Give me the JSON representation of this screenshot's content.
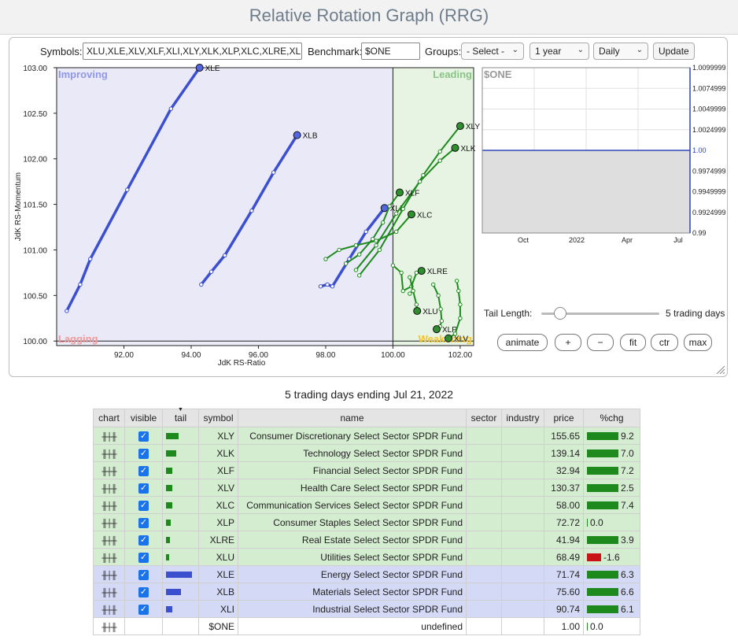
{
  "page": {
    "title": "Relative Rotation Graph (RRG)"
  },
  "controls": {
    "symbols_label": "Symbols:",
    "symbols_value": "XLU,XLE,XLV,XLF,XLI,XLY,XLK,XLP,XLC,XLRE,XLB",
    "benchmark_label": "Benchmark:",
    "benchmark_value": "$ONE",
    "groups_label": "Groups:",
    "groups_value": "- Select -",
    "period_value": "1 year",
    "frequency_value": "Daily",
    "update_label": "Update"
  },
  "chart_data": [
    {
      "type": "scatter",
      "title": "",
      "xlabel": "JdK RS-Ratio",
      "ylabel": "JdK RS-Momentum",
      "xlim": [
        90.0,
        102.4
      ],
      "ylim": [
        99.95,
        103.0
      ],
      "x_ticks": [
        "92.00",
        "94.00",
        "96.00",
        "98.00",
        "100.00",
        "102.00"
      ],
      "y_ticks": [
        "100.00",
        "100.50",
        "101.00",
        "101.50",
        "102.00",
        "102.50",
        "103.00"
      ],
      "quadrants": {
        "top_left": "Improving",
        "top_right": "Leading",
        "bottom_left": "Lagging",
        "bottom_right": "Weakening"
      },
      "colors": {
        "improving": "#e9e9f7",
        "leading": "#e8f4e3",
        "lagging": "#ececf8",
        "weakening": "#e8f4e3",
        "improving_text": "#8f97e6",
        "leading_text": "#88c585",
        "lagging_text": "#ef9a9a",
        "weakening_text": "#f4c430",
        "blue": "#3b4fcf",
        "green": "#1e8a1e"
      },
      "series": [
        {
          "name": "XLE",
          "color": "blue",
          "points": [
            [
              90.3,
              100.33
            ],
            [
              90.7,
              100.62
            ],
            [
              91.0,
              100.9
            ],
            [
              92.1,
              101.66
            ],
            [
              93.4,
              102.55
            ],
            [
              94.25,
              103.0
            ]
          ]
        },
        {
          "name": "XLB",
          "color": "blue",
          "points": [
            [
              94.3,
              100.62
            ],
            [
              94.6,
              100.76
            ],
            [
              95.0,
              100.94
            ],
            [
              95.8,
              101.43
            ],
            [
              96.45,
              101.85
            ],
            [
              97.15,
              102.26
            ]
          ]
        },
        {
          "name": "XLI",
          "color": "blue",
          "points": [
            [
              97.85,
              100.6
            ],
            [
              98.05,
              100.62
            ],
            [
              98.2,
              100.6
            ],
            [
              98.7,
              100.9
            ],
            [
              99.2,
              101.2
            ],
            [
              99.75,
              101.46
            ]
          ]
        },
        {
          "name": "XLY",
          "color": "green",
          "points": [
            [
              99.0,
              100.72
            ],
            [
              99.6,
              101.0
            ],
            [
              100.3,
              101.45
            ],
            [
              100.9,
              101.82
            ],
            [
              101.4,
              102.08
            ],
            [
              102.0,
              102.36
            ]
          ]
        },
        {
          "name": "XLK",
          "color": "green",
          "points": [
            [
              98.9,
              100.78
            ],
            [
              99.5,
              101.05
            ],
            [
              100.1,
              101.4
            ],
            [
              100.8,
              101.75
            ],
            [
              101.4,
              101.98
            ],
            [
              101.85,
              102.12
            ]
          ]
        },
        {
          "name": "XLF",
          "color": "green",
          "points": [
            [
              98.6,
              100.85
            ],
            [
              99.0,
              100.95
            ],
            [
              99.4,
              101.12
            ],
            [
              99.7,
              101.3
            ],
            [
              99.9,
              101.48
            ],
            [
              100.2,
              101.63
            ]
          ]
        },
        {
          "name": "XLC",
          "color": "green",
          "points": [
            [
              98.0,
              100.9
            ],
            [
              98.4,
              101.0
            ],
            [
              98.9,
              101.05
            ],
            [
              99.5,
              101.1
            ],
            [
              100.1,
              101.2
            ],
            [
              100.55,
              101.39
            ]
          ]
        },
        {
          "name": "XLRE",
          "color": "green",
          "points": [
            [
              100.0,
              100.83
            ],
            [
              100.25,
              100.75
            ],
            [
              100.3,
              100.55
            ],
            [
              100.55,
              100.6
            ],
            [
              100.7,
              100.75
            ],
            [
              100.85,
              100.77
            ]
          ]
        },
        {
          "name": "XLU",
          "color": "green",
          "points": [
            [
              100.5,
              100.52
            ],
            [
              100.6,
              100.55
            ],
            [
              100.5,
              100.7
            ],
            [
              100.6,
              100.55
            ],
            [
              100.7,
              100.4
            ],
            [
              100.72,
              100.33
            ]
          ]
        },
        {
          "name": "XLP",
          "color": "green",
          "points": [
            [
              101.2,
              100.62
            ],
            [
              101.35,
              100.5
            ],
            [
              101.42,
              100.35
            ],
            [
              101.45,
              100.22
            ],
            [
              101.4,
              100.16
            ],
            [
              101.3,
              100.13
            ]
          ]
        },
        {
          "name": "XLV",
          "color": "green",
          "points": [
            [
              101.9,
              100.66
            ],
            [
              101.95,
              100.55
            ],
            [
              102.0,
              100.4
            ],
            [
              102.0,
              100.25
            ],
            [
              101.85,
              100.08
            ],
            [
              101.65,
              100.03
            ]
          ]
        }
      ]
    },
    {
      "type": "line",
      "title": "",
      "legend_label": "$ONE",
      "x_ticks": [
        "Oct",
        "2022",
        "Apr",
        "Jul"
      ],
      "y_ticks": [
        "1.0099999",
        "1.0074999",
        "1.0049999",
        "1.0024999",
        "1.00",
        "0.9974999",
        "0.9949999",
        "0.9924999",
        "0.99"
      ],
      "ylim": [
        0.99,
        1.01
      ],
      "series": [
        {
          "name": "$ONE",
          "values": [
            1.0,
            1.0
          ]
        }
      ]
    }
  ],
  "tail": {
    "label": "Tail Length:",
    "value_text": "5 trading days",
    "value": 5
  },
  "buttons": {
    "animate": "animate",
    "plus": "+",
    "minus": "−",
    "fit": "fit",
    "ctr": "ctr",
    "max": "max"
  },
  "period_text": "5 trading days ending Jul 21, 2022",
  "table": {
    "headers": {
      "chart": "chart",
      "visible": "visible",
      "tail": "tail",
      "symbol": "symbol",
      "name": "name",
      "sector": "sector",
      "industry": "industry",
      "price": "price",
      "chg": "%chg"
    },
    "rows": [
      {
        "symbol": "XLY",
        "name": "Consumer Discretionary Select Sector SPDR Fund",
        "price": "155.65",
        "chg": "9.2",
        "group": "g",
        "tail": 16
      },
      {
        "symbol": "XLK",
        "name": "Technology Select Sector SPDR Fund",
        "price": "139.14",
        "chg": "7.0",
        "group": "g",
        "tail": 13
      },
      {
        "symbol": "XLF",
        "name": "Financial Select Sector SPDR Fund",
        "price": "32.94",
        "chg": "7.2",
        "group": "g",
        "tail": 8
      },
      {
        "symbol": "XLV",
        "name": "Health Care Select Sector SPDR Fund",
        "price": "130.37",
        "chg": "2.5",
        "group": "g",
        "tail": 8
      },
      {
        "symbol": "XLC",
        "name": "Communication Services Select Sector SPDR Fund",
        "price": "58.00",
        "chg": "7.4",
        "group": "g",
        "tail": 8
      },
      {
        "symbol": "XLP",
        "name": "Consumer Staples Select Sector SPDR Fund",
        "price": "72.72",
        "chg": "0.0",
        "group": "g",
        "tail": 6
      },
      {
        "symbol": "XLRE",
        "name": "Real Estate Select Sector SPDR Fund",
        "price": "41.94",
        "chg": "3.9",
        "group": "g",
        "tail": 5
      },
      {
        "symbol": "XLU",
        "name": "Utilities Select Sector SPDR Fund",
        "price": "68.49",
        "chg": "-1.6",
        "group": "g",
        "tail": 4
      },
      {
        "symbol": "XLE",
        "name": "Energy Select Sector SPDR Fund",
        "price": "71.74",
        "chg": "6.3",
        "group": "b",
        "tail": 33
      },
      {
        "symbol": "XLB",
        "name": "Materials Select Sector SPDR Fund",
        "price": "75.60",
        "chg": "6.6",
        "group": "b",
        "tail": 19
      },
      {
        "symbol": "XLI",
        "name": "Industrial Select Sector SPDR Fund",
        "price": "90.74",
        "chg": "6.1",
        "group": "b",
        "tail": 8
      },
      {
        "symbol": "$ONE",
        "name": "undefined",
        "price": "1.00",
        "chg": "0.0",
        "group": "w",
        "tail": 0
      }
    ]
  }
}
